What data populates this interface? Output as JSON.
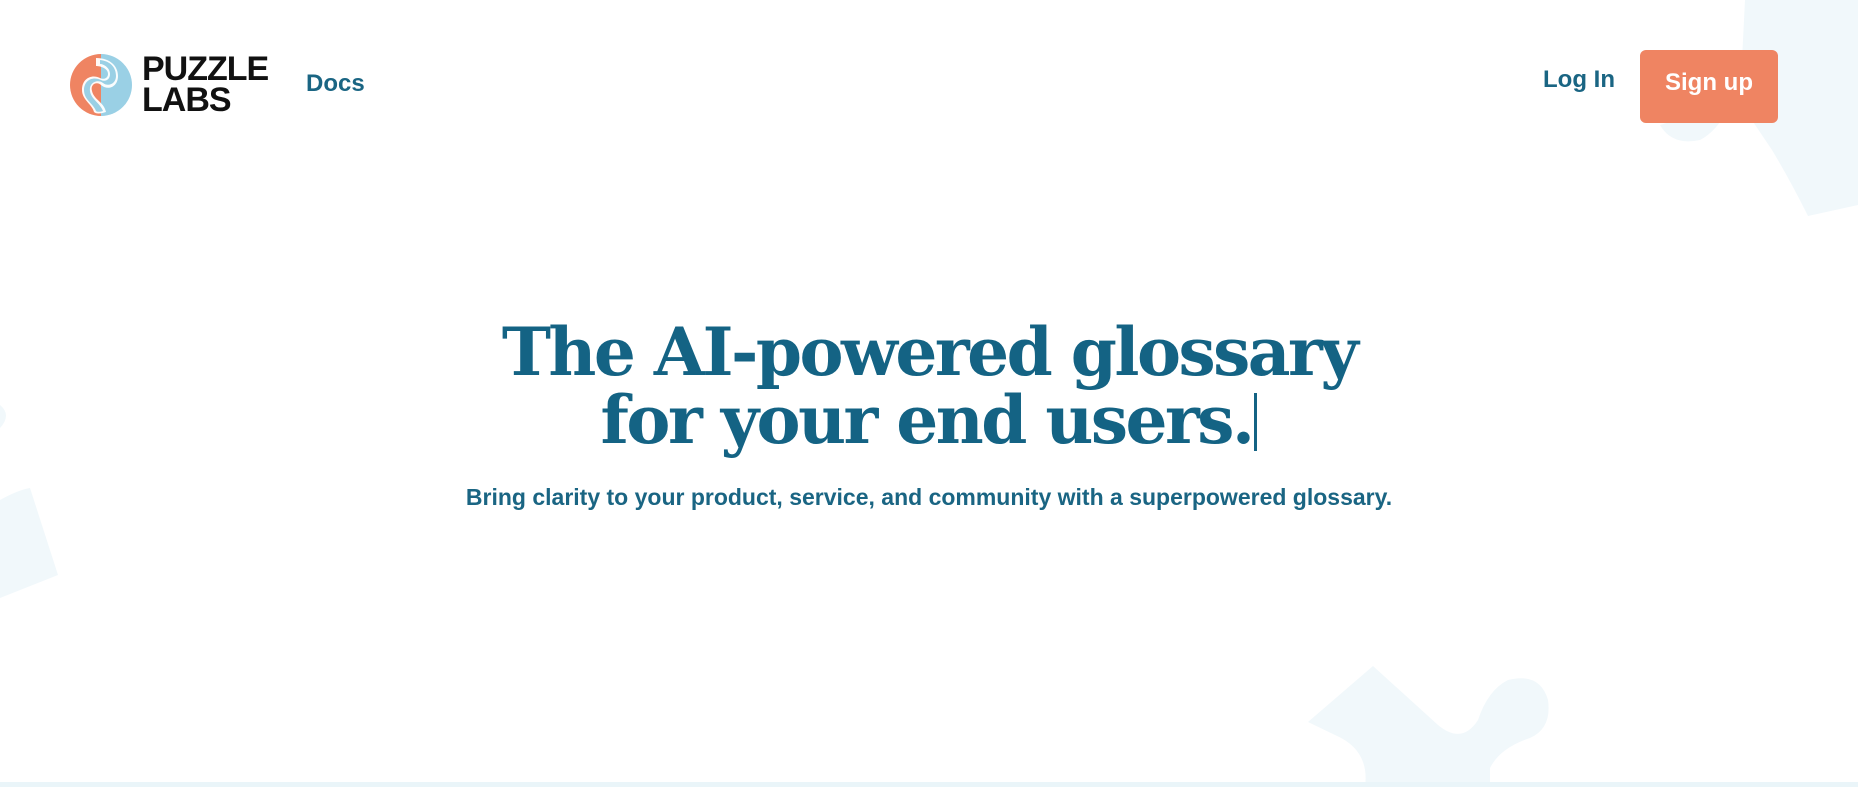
{
  "brand": {
    "line1": "PUZZLE",
    "line2": "LABS"
  },
  "nav": {
    "docs_label": "Docs",
    "login_label": "Log In",
    "signup_label": "Sign up"
  },
  "hero": {
    "title_line1": "The AI-powered glossary",
    "title_line2": "for your end users.",
    "subtitle": "Bring clarity to your product, service, and community with a superpowered glossary."
  },
  "colors": {
    "primary": "#146384",
    "accent": "#ef8462",
    "logo_orange": "#ef8462",
    "logo_blue": "#9ad0e5",
    "background": "#ffffff",
    "decor": "#f1f8fb"
  },
  "icons": {
    "logo": "puzzle-labs-logo-icon",
    "text_cursor": "text-cursor-icon",
    "decor": "puzzle-piece-icon"
  }
}
